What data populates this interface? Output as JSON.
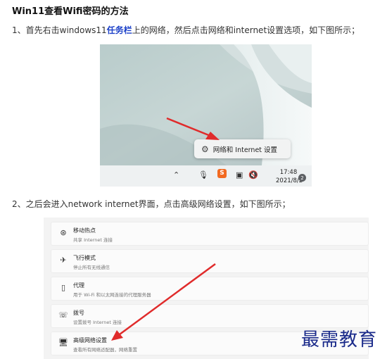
{
  "article": {
    "title": "Win11查看Wifi密码的方法",
    "step1_prefix": "1、首先右击windows11",
    "step1_highlight": "任务栏",
    "step1_suffix": "上的网络，然后点击网络和internet设置选项，如下图所示；",
    "step2": "2、之后会进入network internet界面，点击高级网络设置，如下图所示；"
  },
  "screenshot1": {
    "context_menu_label": "网络和 Internet 设置",
    "context_menu_icon": "gear-icon",
    "taskbar": {
      "chevron_icon": "chevron-up-icon",
      "mic_icon": "microphone-icon",
      "ime_label": "S",
      "network_icon": "network-icon",
      "volume_icon": "volume-mute-icon",
      "time": "17:48",
      "date": "2021/8/2",
      "notification_count": "2"
    },
    "arrow_color": "#e02b2b"
  },
  "screenshot2": {
    "rows": [
      {
        "icon": "hotspot-icon",
        "title": "移动热点",
        "subtitle": "共享 Internet 连接"
      },
      {
        "icon": "airplane-icon",
        "title": "飞行模式",
        "subtitle": "停止所有无线通信"
      },
      {
        "icon": "proxy-icon",
        "title": "代理",
        "subtitle": "用于 Wi-Fi 和以太网连接的代理服务器"
      },
      {
        "icon": "dialup-icon",
        "title": "拨号",
        "subtitle": "设置拨号 Internet 连接"
      },
      {
        "icon": "monitor-icon",
        "title": "高级网络设置",
        "subtitle": "查看所有网络适配器，网络重置"
      }
    ],
    "arrow_color": "#e02b2b"
  },
  "watermark": "最需教育"
}
